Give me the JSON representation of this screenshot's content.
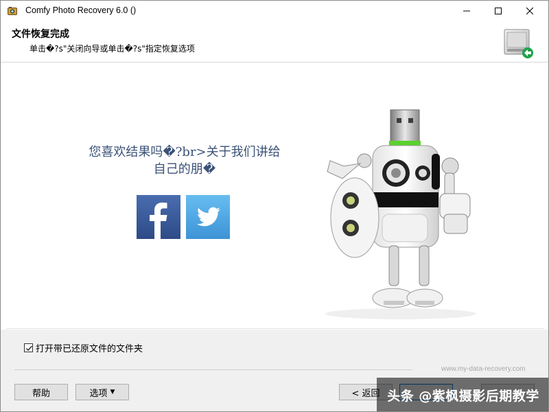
{
  "window": {
    "title": "Comfy Photo Recovery 6.0 ()"
  },
  "header": {
    "title": "文件恢复完成",
    "subtitle": "单击�?s\"关闭向导或单击�?s\"指定恢复选项"
  },
  "content": {
    "promo_line1": "您喜欢结果吗�?br>关于我们讲给",
    "promo_line2": "自己的朋�"
  },
  "bottom": {
    "checkbox_label": "打开带已还原文件的文件夹",
    "checkbox_checked": true,
    "website": "www.my-data-recovery.com",
    "help_label": "帮助",
    "options_label": "选项",
    "back_label": "< 返回"
  },
  "watermark": {
    "text": "头条 @紫枫摄影后期教学"
  },
  "colors": {
    "accent": "#0078d7",
    "promo_text": "#3b5177",
    "facebook": "#3b5998",
    "twitter": "#55acee"
  }
}
